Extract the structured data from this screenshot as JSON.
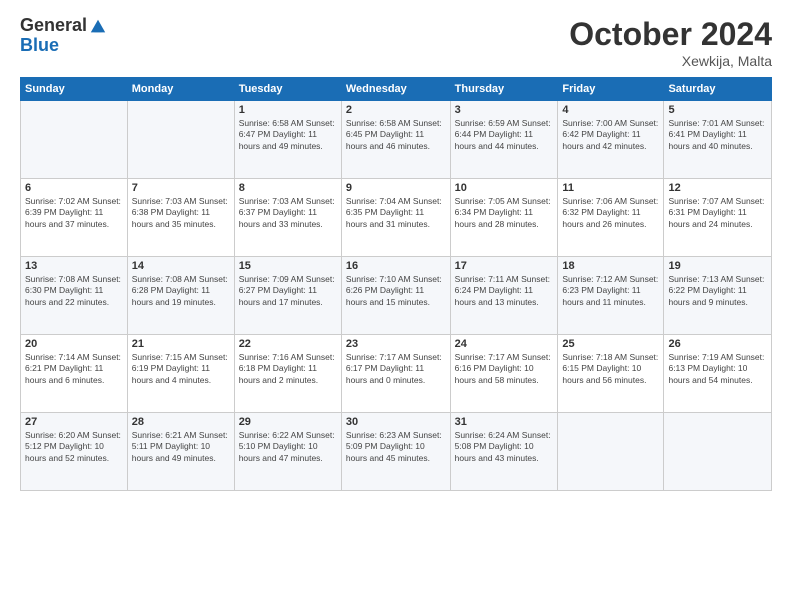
{
  "logo": {
    "general": "General",
    "blue": "Blue"
  },
  "header": {
    "month": "October 2024",
    "location": "Xewkija, Malta"
  },
  "weekdays": [
    "Sunday",
    "Monday",
    "Tuesday",
    "Wednesday",
    "Thursday",
    "Friday",
    "Saturday"
  ],
  "weeks": [
    [
      {
        "day": "",
        "info": ""
      },
      {
        "day": "",
        "info": ""
      },
      {
        "day": "1",
        "info": "Sunrise: 6:58 AM\nSunset: 6:47 PM\nDaylight: 11 hours and 49 minutes."
      },
      {
        "day": "2",
        "info": "Sunrise: 6:58 AM\nSunset: 6:45 PM\nDaylight: 11 hours and 46 minutes."
      },
      {
        "day": "3",
        "info": "Sunrise: 6:59 AM\nSunset: 6:44 PM\nDaylight: 11 hours and 44 minutes."
      },
      {
        "day": "4",
        "info": "Sunrise: 7:00 AM\nSunset: 6:42 PM\nDaylight: 11 hours and 42 minutes."
      },
      {
        "day": "5",
        "info": "Sunrise: 7:01 AM\nSunset: 6:41 PM\nDaylight: 11 hours and 40 minutes."
      }
    ],
    [
      {
        "day": "6",
        "info": "Sunrise: 7:02 AM\nSunset: 6:39 PM\nDaylight: 11 hours and 37 minutes."
      },
      {
        "day": "7",
        "info": "Sunrise: 7:03 AM\nSunset: 6:38 PM\nDaylight: 11 hours and 35 minutes."
      },
      {
        "day": "8",
        "info": "Sunrise: 7:03 AM\nSunset: 6:37 PM\nDaylight: 11 hours and 33 minutes."
      },
      {
        "day": "9",
        "info": "Sunrise: 7:04 AM\nSunset: 6:35 PM\nDaylight: 11 hours and 31 minutes."
      },
      {
        "day": "10",
        "info": "Sunrise: 7:05 AM\nSunset: 6:34 PM\nDaylight: 11 hours and 28 minutes."
      },
      {
        "day": "11",
        "info": "Sunrise: 7:06 AM\nSunset: 6:32 PM\nDaylight: 11 hours and 26 minutes."
      },
      {
        "day": "12",
        "info": "Sunrise: 7:07 AM\nSunset: 6:31 PM\nDaylight: 11 hours and 24 minutes."
      }
    ],
    [
      {
        "day": "13",
        "info": "Sunrise: 7:08 AM\nSunset: 6:30 PM\nDaylight: 11 hours and 22 minutes."
      },
      {
        "day": "14",
        "info": "Sunrise: 7:08 AM\nSunset: 6:28 PM\nDaylight: 11 hours and 19 minutes."
      },
      {
        "day": "15",
        "info": "Sunrise: 7:09 AM\nSunset: 6:27 PM\nDaylight: 11 hours and 17 minutes."
      },
      {
        "day": "16",
        "info": "Sunrise: 7:10 AM\nSunset: 6:26 PM\nDaylight: 11 hours and 15 minutes."
      },
      {
        "day": "17",
        "info": "Sunrise: 7:11 AM\nSunset: 6:24 PM\nDaylight: 11 hours and 13 minutes."
      },
      {
        "day": "18",
        "info": "Sunrise: 7:12 AM\nSunset: 6:23 PM\nDaylight: 11 hours and 11 minutes."
      },
      {
        "day": "19",
        "info": "Sunrise: 7:13 AM\nSunset: 6:22 PM\nDaylight: 11 hours and 9 minutes."
      }
    ],
    [
      {
        "day": "20",
        "info": "Sunrise: 7:14 AM\nSunset: 6:21 PM\nDaylight: 11 hours and 6 minutes."
      },
      {
        "day": "21",
        "info": "Sunrise: 7:15 AM\nSunset: 6:19 PM\nDaylight: 11 hours and 4 minutes."
      },
      {
        "day": "22",
        "info": "Sunrise: 7:16 AM\nSunset: 6:18 PM\nDaylight: 11 hours and 2 minutes."
      },
      {
        "day": "23",
        "info": "Sunrise: 7:17 AM\nSunset: 6:17 PM\nDaylight: 11 hours and 0 minutes."
      },
      {
        "day": "24",
        "info": "Sunrise: 7:17 AM\nSunset: 6:16 PM\nDaylight: 10 hours and 58 minutes."
      },
      {
        "day": "25",
        "info": "Sunrise: 7:18 AM\nSunset: 6:15 PM\nDaylight: 10 hours and 56 minutes."
      },
      {
        "day": "26",
        "info": "Sunrise: 7:19 AM\nSunset: 6:13 PM\nDaylight: 10 hours and 54 minutes."
      }
    ],
    [
      {
        "day": "27",
        "info": "Sunrise: 6:20 AM\nSunset: 5:12 PM\nDaylight: 10 hours and 52 minutes."
      },
      {
        "day": "28",
        "info": "Sunrise: 6:21 AM\nSunset: 5:11 PM\nDaylight: 10 hours and 49 minutes."
      },
      {
        "day": "29",
        "info": "Sunrise: 6:22 AM\nSunset: 5:10 PM\nDaylight: 10 hours and 47 minutes."
      },
      {
        "day": "30",
        "info": "Sunrise: 6:23 AM\nSunset: 5:09 PM\nDaylight: 10 hours and 45 minutes."
      },
      {
        "day": "31",
        "info": "Sunrise: 6:24 AM\nSunset: 5:08 PM\nDaylight: 10 hours and 43 minutes."
      },
      {
        "day": "",
        "info": ""
      },
      {
        "day": "",
        "info": ""
      }
    ]
  ]
}
